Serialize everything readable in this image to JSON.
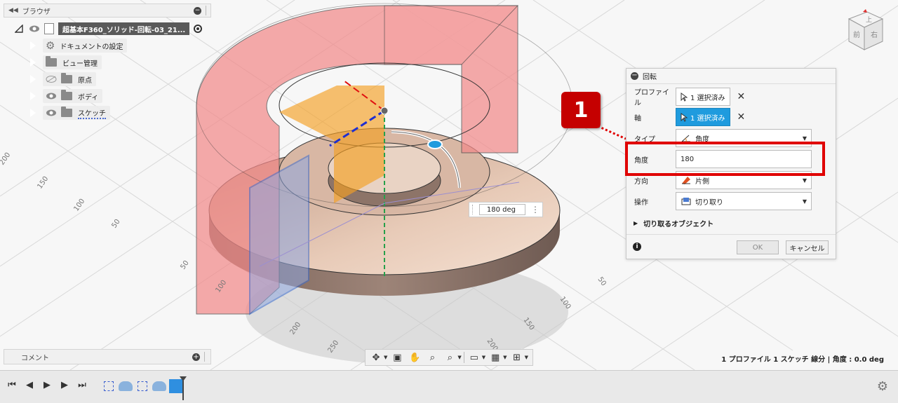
{
  "browser": {
    "title": "ブラウザ",
    "root": "超基本F360_ソリッド-回転-03_21...",
    "items": [
      {
        "label": "ドキュメントの設定",
        "icon": "gear-icon"
      },
      {
        "label": "ビュー管理",
        "icon": "folder-icon"
      },
      {
        "label": "原点",
        "icon": "folder-icon"
      },
      {
        "label": "ボディ",
        "icon": "folder-icon"
      },
      {
        "label": "スケッチ",
        "icon": "folder-icon"
      }
    ]
  },
  "comment": {
    "label": "コメント"
  },
  "dialog": {
    "title": "回転",
    "profile_label": "プロファイル",
    "profile_value": "1 選択済み",
    "axis_label": "軸",
    "axis_value": "1 選択済み",
    "type_label": "タイプ",
    "type_value": "角度",
    "angle_label": "角度",
    "angle_value": "180",
    "direction_label": "方向",
    "direction_value": "片側",
    "operation_label": "操作",
    "operation_value": "切り取り",
    "cut_objects_label": "切り取るオブジェクト",
    "ok_label": "OK",
    "cancel_label": "キャンセル"
  },
  "callout": {
    "number": "1",
    "color": "#d00000"
  },
  "value_pill": {
    "value": "180 deg"
  },
  "viewcube": {
    "top": "上",
    "front": "前",
    "right": "右"
  },
  "status": {
    "text": "1 プロファイル 1 スケッチ 線分 | 角度 : 0.0 deg"
  },
  "axis_ticks": {
    "left": [
      "200",
      "150",
      "100",
      "50",
      "50",
      "100"
    ],
    "bottom": [
      "200",
      "250"
    ],
    "right": [
      "50",
      "100",
      "150",
      "200"
    ]
  },
  "colors": {
    "accent": "#1f9bde",
    "cut_body": "#f28a8a",
    "body": "#c9a48c"
  }
}
